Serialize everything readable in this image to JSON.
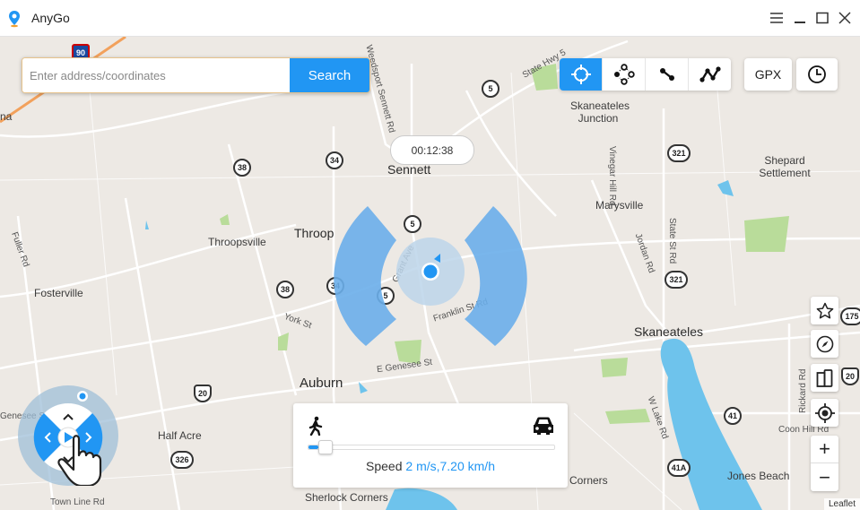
{
  "window": {
    "title": "AnyGo",
    "controls": [
      "menu",
      "minimize",
      "maximize",
      "close"
    ]
  },
  "search": {
    "placeholder": "Enter address/coordinates",
    "value": "",
    "button_label": "Search"
  },
  "toolbar": {
    "modes": [
      {
        "name": "teleport",
        "icon": "crosshair-icon",
        "active": true
      },
      {
        "name": "jump-teleport",
        "icon": "multi-spot-icon",
        "active": false
      },
      {
        "name": "two-spot",
        "icon": "two-spot-route-icon",
        "active": false
      },
      {
        "name": "multi-spot",
        "icon": "multi-spot-route-icon",
        "active": false
      }
    ],
    "gpx_label": "GPX",
    "history_icon": "clock-icon"
  },
  "timer": {
    "value": "00:12:38"
  },
  "map": {
    "places": [
      {
        "text": "Sennett",
        "class": "big"
      },
      {
        "text": "Throop",
        "class": "big"
      },
      {
        "text": "Throopsville"
      },
      {
        "text": "Fosterville"
      },
      {
        "text": "Auburn",
        "class": "big"
      },
      {
        "text": "Half Acre"
      },
      {
        "text": "Skaneateles Junction"
      },
      {
        "text": "Marysville"
      },
      {
        "text": "Shepard Settlement"
      },
      {
        "text": "Skaneateles",
        "class": "big"
      },
      {
        "text": "Jones Beach"
      },
      {
        "text": "Corners"
      },
      {
        "text": "Sherlock Corners"
      },
      {
        "text": "na"
      }
    ],
    "roads": [
      "Grant Ave",
      "Franklin St Rd",
      "E Genesee St",
      "York St",
      "Fuller Rd",
      "Vinegar Hill Rd",
      "Jordan Rd",
      "State St Rd",
      "State Hwy 5",
      "W Lake Rd",
      "Rickard Rd",
      "Coon Hill Rd",
      "Town Line Rd",
      "Genesee St",
      "Weedsport Sennett Rd"
    ],
    "shields": [
      "5",
      "5",
      "5",
      "34",
      "34",
      "38",
      "38",
      "20",
      "20",
      "321",
      "321",
      "326",
      "41",
      "41A",
      "175",
      "90"
    ],
    "attribution": "Leaflet"
  },
  "side_controls": {
    "items": [
      "favorite",
      "compass",
      "multi-device",
      "locate"
    ],
    "zoom_in": "+",
    "zoom_out": "−"
  },
  "speed": {
    "label": "Speed",
    "value_text": "2 m/s,7.20 km/h",
    "fraction": 0.04,
    "min_icon": "walk-icon",
    "max_icon": "car-icon"
  },
  "colors": {
    "accent": "#2196f3",
    "map_bg": "#ede9e4",
    "water": "#6ec3ec",
    "park": "#b9dc9a",
    "range_arc": "#6aaeea"
  }
}
